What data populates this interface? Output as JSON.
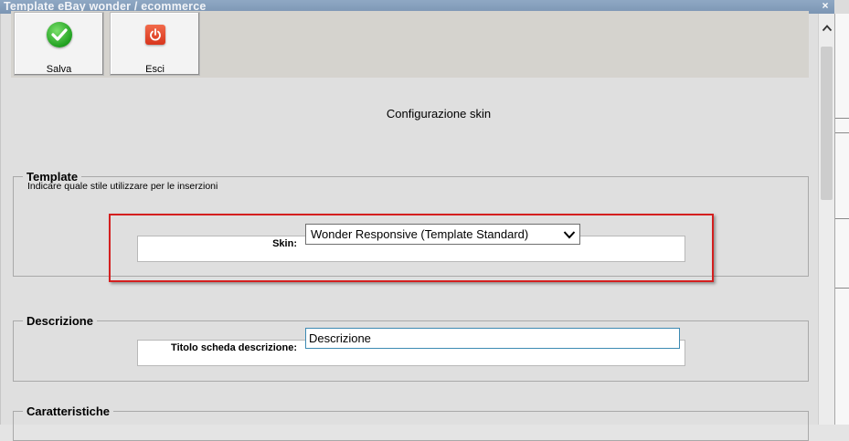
{
  "window": {
    "title": "Template eBay wonder / ecommerce",
    "close_glyph": "×"
  },
  "toolbar": {
    "save_label": "Salva",
    "save_icon": "check-circle-icon",
    "exit_label": "Esci",
    "exit_icon": "power-icon"
  },
  "page": {
    "heading": "Configurazione skin"
  },
  "template_group": {
    "legend": "Template",
    "hint": "Indicare quale stile utilizzare per le inserzioni",
    "skin_label": "Skin:",
    "skin_value": "Wonder Responsive (Template Standard)"
  },
  "description_group": {
    "legend": "Descrizione",
    "title_label": "Titolo scheda descrizione:",
    "title_value": "Descrizione"
  },
  "features_group": {
    "legend": "Caratteristiche"
  },
  "colors": {
    "highlight": "#d41f1f",
    "toolbar_bg": "#d5d3ce",
    "ok_green": "#20a020",
    "exit_red": "#d8351d"
  }
}
